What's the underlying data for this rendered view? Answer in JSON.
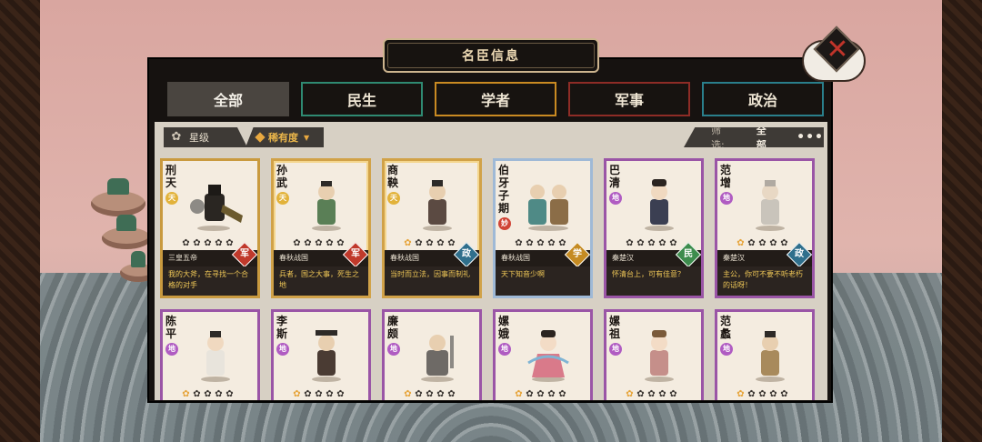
{
  "title": "名臣信息",
  "tabs": [
    {
      "label": "全部",
      "active": true
    },
    {
      "label": "民生"
    },
    {
      "label": "学者"
    },
    {
      "label": "军事"
    },
    {
      "label": "政治"
    }
  ],
  "filters": {
    "star_label": "星级",
    "rarity_label": "稀有度",
    "screen_label": "筛选:",
    "screen_value": "全部",
    "more": "•••"
  },
  "cards_row1": [
    {
      "name": "刑天",
      "grade": "天",
      "stars": 0,
      "era": "三皇五帝",
      "dept": "军",
      "quote": "我的大斧，在寻找一个合格的对手"
    },
    {
      "name": "孙武",
      "grade": "天",
      "stars": 0,
      "era": "春秋战国",
      "dept": "军",
      "quote": "兵者，国之大事，死生之地"
    },
    {
      "name": "商鞅",
      "grade": "天",
      "stars": 1,
      "era": "春秋战国",
      "dept": "政",
      "quote": "当时而立法，因事而制礼"
    },
    {
      "name": "伯牙子期",
      "grade": "妙",
      "stars": 0,
      "era": "春秋战国",
      "dept": "学",
      "quote": "天下知音少啊"
    },
    {
      "name": "巴清",
      "grade": "地",
      "stars": 0,
      "era": "秦楚汉",
      "dept": "民",
      "quote": "怀清台上，可有佳意？"
    },
    {
      "name": "范增",
      "grade": "地",
      "stars": 1,
      "era": "秦楚汉",
      "dept": "政",
      "quote": "主公，你可不要不听老朽的话呀！"
    }
  ],
  "cards_row2": [
    {
      "name": "陈平",
      "grade": "地",
      "stars": 1
    },
    {
      "name": "李斯",
      "grade": "地",
      "stars": 1
    },
    {
      "name": "廉颇",
      "grade": "地",
      "stars": 1
    },
    {
      "name": "嫘娥",
      "grade": "地",
      "stars": 1
    },
    {
      "name": "嫘祖",
      "grade": "地",
      "stars": 1
    },
    {
      "name": "范蠡",
      "grade": "地",
      "stars": 1
    }
  ],
  "colors": {
    "gold": "#c99a3f",
    "purple": "#9a55a6",
    "blue": "#9fb9d6",
    "accent_text": "#f0c857"
  }
}
